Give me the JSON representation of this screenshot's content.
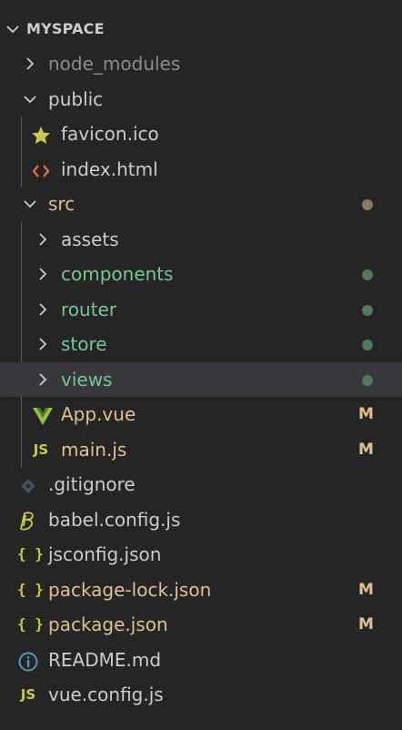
{
  "explorer": {
    "section_title": "MYSPACE",
    "colors": {
      "background": "#252526",
      "selected_row": "#37373d",
      "modified": "#e2c08d",
      "untracked_green": "#73c991",
      "ignored": "#8c8c8c"
    },
    "rows": [
      {
        "label": "node_modules",
        "kind": "folder",
        "expanded": false,
        "icon": "chevron-right-icon"
      },
      {
        "label": "public",
        "kind": "folder",
        "expanded": true,
        "icon": "chevron-down-icon"
      },
      {
        "label": "favicon.ico",
        "kind": "file",
        "icon": "star-icon"
      },
      {
        "label": "index.html",
        "kind": "file",
        "icon": "html-code-icon"
      },
      {
        "label": "src",
        "kind": "folder",
        "expanded": true,
        "icon": "chevron-down-icon",
        "status": "dot"
      },
      {
        "label": "assets",
        "kind": "folder",
        "expanded": false,
        "icon": "chevron-right-icon"
      },
      {
        "label": "components",
        "kind": "folder",
        "expanded": false,
        "icon": "chevron-right-icon",
        "status": "dot"
      },
      {
        "label": "router",
        "kind": "folder",
        "expanded": false,
        "icon": "chevron-right-icon",
        "status": "dot"
      },
      {
        "label": "store",
        "kind": "folder",
        "expanded": false,
        "icon": "chevron-right-icon",
        "status": "dot"
      },
      {
        "label": "views",
        "kind": "folder",
        "expanded": false,
        "icon": "chevron-right-icon",
        "status": "dot",
        "selected": true
      },
      {
        "label": "App.vue",
        "kind": "file",
        "icon": "vue-icon",
        "status": "M"
      },
      {
        "label": "main.js",
        "kind": "file",
        "icon": "js-icon",
        "status": "M"
      },
      {
        "label": ".gitignore",
        "kind": "file",
        "icon": "git-icon"
      },
      {
        "label": "babel.config.js",
        "kind": "file",
        "icon": "babel-icon"
      },
      {
        "label": "jsconfig.json",
        "kind": "file",
        "icon": "json-icon"
      },
      {
        "label": "package-lock.json",
        "kind": "file",
        "icon": "json-icon",
        "status": "M"
      },
      {
        "label": "package.json",
        "kind": "file",
        "icon": "json-icon",
        "status": "M"
      },
      {
        "label": "README.md",
        "kind": "file",
        "icon": "info-icon"
      },
      {
        "label": "vue.config.js",
        "kind": "file",
        "icon": "js-icon"
      }
    ],
    "icon_text": {
      "js": "JS",
      "json": "{ }"
    }
  }
}
